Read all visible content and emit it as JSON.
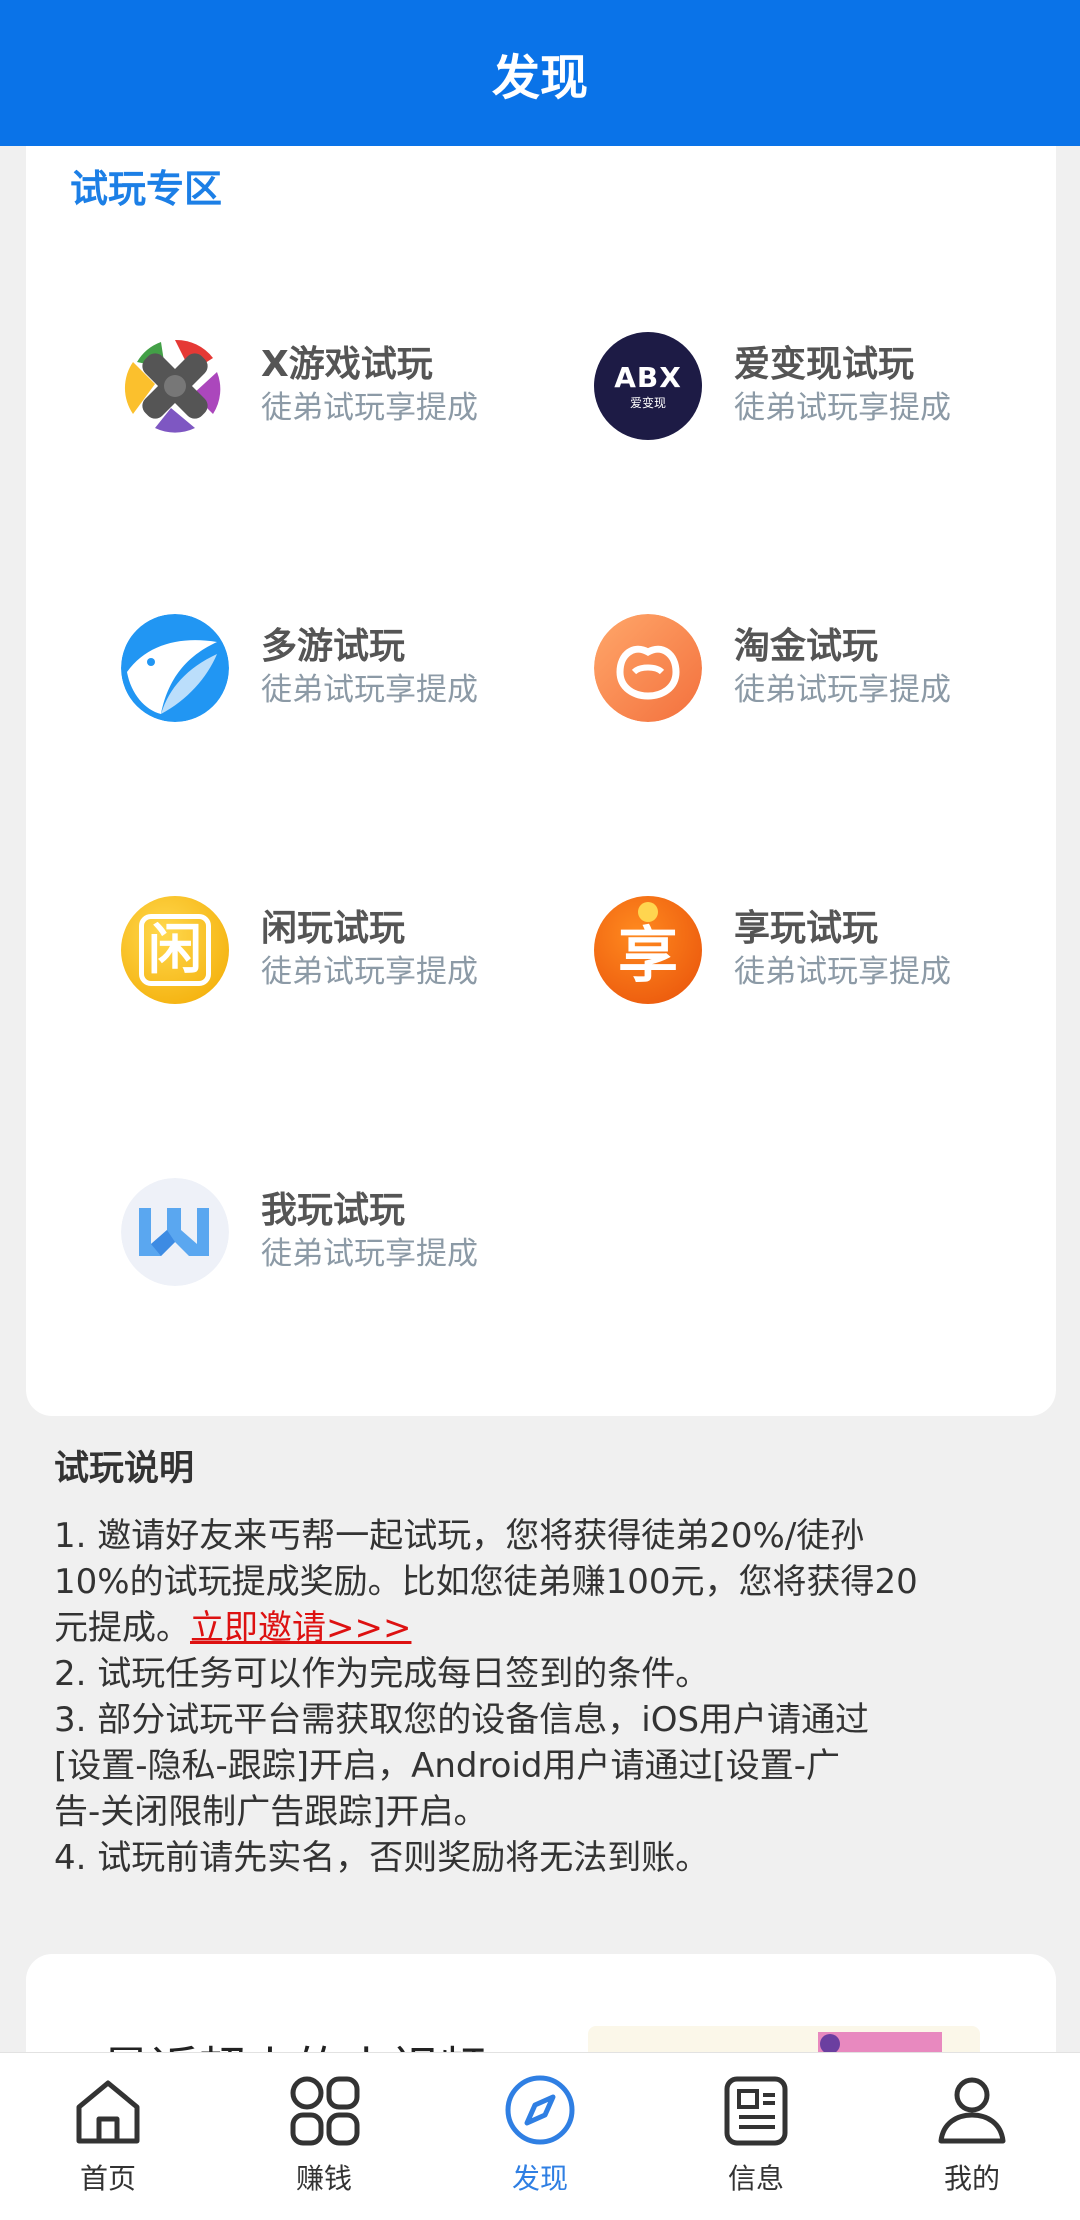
{
  "header": {
    "title": "发现"
  },
  "trial": {
    "section_title": "试玩专区",
    "items": [
      {
        "title": "X游戏试玩",
        "subtitle": "徒弟试玩享提成",
        "icon": "x-game-icon"
      },
      {
        "title": "爱变现试玩",
        "subtitle": "徒弟试玩享提成",
        "icon": "abx-icon",
        "logo_text": "ABX",
        "logo_sub": "爱变现"
      },
      {
        "title": "多游试玩",
        "subtitle": "徒弟试玩享提成",
        "icon": "duoyou-icon"
      },
      {
        "title": "淘金试玩",
        "subtitle": "徒弟试玩享提成",
        "icon": "taojin-icon"
      },
      {
        "title": "闲玩试玩",
        "subtitle": "徒弟试玩享提成",
        "icon": "xianwan-icon",
        "logo_text": "闲"
      },
      {
        "title": "享玩试玩",
        "subtitle": "徒弟试玩享提成",
        "icon": "xiangwan-icon",
        "logo_text": "享"
      },
      {
        "title": "我玩试玩",
        "subtitle": "徒弟试玩享提成",
        "icon": "wowan-icon"
      }
    ]
  },
  "desc": {
    "title": "试玩说明",
    "line1a": "1. 邀请好友来丐帮一起试玩，您将获得徒弟20%/徒孙",
    "line1b": "10%的试玩提成奖励。比如您徒弟赚100元，您将获得20",
    "line1c": "元提成。",
    "invite_link": "立即邀请>>>",
    "line2": "2. 试玩任务可以作为完成每日签到的条件。",
    "line3a": "3. 部分试玩平台需获取您的设备信息，iOS用户请通过",
    "line3b": "[设置-隐私-跟踪]开启，Android用户请通过[设置-广",
    "line3c": "告-关闭限制广告跟踪]开启。",
    "line4": "4. 试玩前请先实名，否则奖励将无法到账。"
  },
  "news": {
    "title": "最近超火的小视频"
  },
  "tabbar": {
    "tabs": [
      {
        "label": "首页",
        "icon": "home-icon"
      },
      {
        "label": "赚钱",
        "icon": "grid-icon"
      },
      {
        "label": "发现",
        "icon": "compass-icon",
        "active": true
      },
      {
        "label": "信息",
        "icon": "news-icon"
      },
      {
        "label": "我的",
        "icon": "user-icon"
      }
    ]
  },
  "colors": {
    "primary": "#0a73e8",
    "link": "#dd1111",
    "active_tab": "#2f7fe3"
  }
}
